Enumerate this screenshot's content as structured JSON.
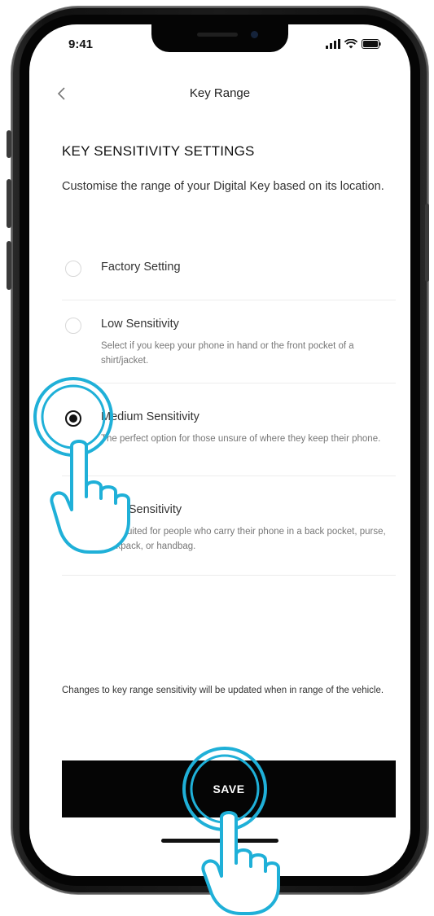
{
  "status_bar": {
    "time": "9:41"
  },
  "nav": {
    "title": "Key Range",
    "back_icon": "chevron-left-icon"
  },
  "section": {
    "heading": "KEY SENSITIVITY SETTINGS",
    "description": "Customise the range of your Digital Key based on its location."
  },
  "options": [
    {
      "label": "Factory Setting",
      "description": "",
      "selected": false
    },
    {
      "label": "Low Sensitivity",
      "description": "Select if you keep your phone in hand or the front pocket of a shirt/jacket.",
      "selected": false
    },
    {
      "label": "Medium Sensitivity",
      "description": "The perfect option for those unsure of where they keep their phone.",
      "selected": true
    },
    {
      "label": "High Sensitivity",
      "description": "Best suited for people who carry their phone in a back pocket, purse, backpack, or handbag.",
      "selected": false
    }
  ],
  "footer": {
    "note": "Changes to key range sensitivity will be updated when in range of the vehicle."
  },
  "save_button": {
    "label": "SAVE"
  },
  "colors": {
    "accent_highlight": "#1fb0d8",
    "button_bg": "#050505",
    "button_text": "#ffffff"
  }
}
